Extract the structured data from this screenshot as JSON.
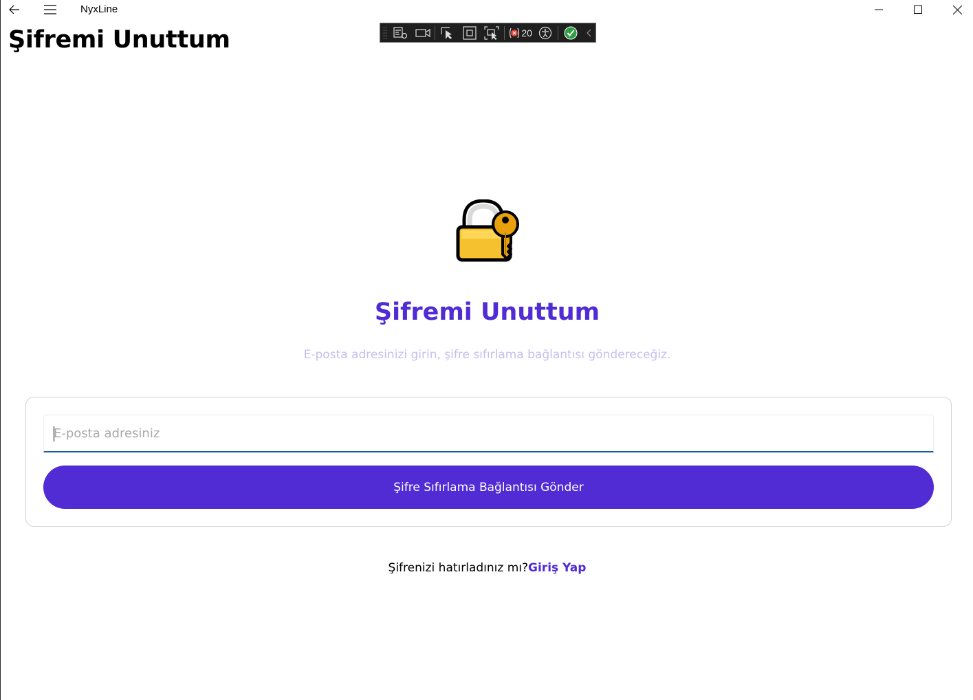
{
  "window": {
    "app_title": "NyxLine",
    "page_title": "Şifremi Unuttum"
  },
  "debug_toolbar": {
    "binding_failures_count": "20",
    "icons": [
      "grip-icon",
      "live-visual-tree-icon",
      "video-icon",
      "select-element-icon",
      "display-layout-adorners-icon",
      "track-focus-icon",
      "binding-failures-icon",
      "accessibility-checker-icon",
      "hot-reload-ok-icon",
      "collapse-chevron-icon"
    ]
  },
  "main": {
    "icon": "lock-with-key-icon",
    "heading": "Şifremi Unuttum",
    "subtitle": "E-posta adresinizi girin, şifre sıfırlama bağlantısı göndereceğiz.",
    "email_placeholder": "E-posta adresiniz",
    "email_value": "",
    "send_button_label": "Şifre Sıfırlama Bağlantısı Gönder",
    "remember_text": "Şifrenizi hatırladınız mı?",
    "login_link_label": "Giriş Yap"
  },
  "colors": {
    "accent": "#512bd4",
    "subtitle": "#c8bdf0",
    "input_underline": "#1a5aa8",
    "lock_body": "#f5b92e",
    "key": "#e8a00c"
  }
}
